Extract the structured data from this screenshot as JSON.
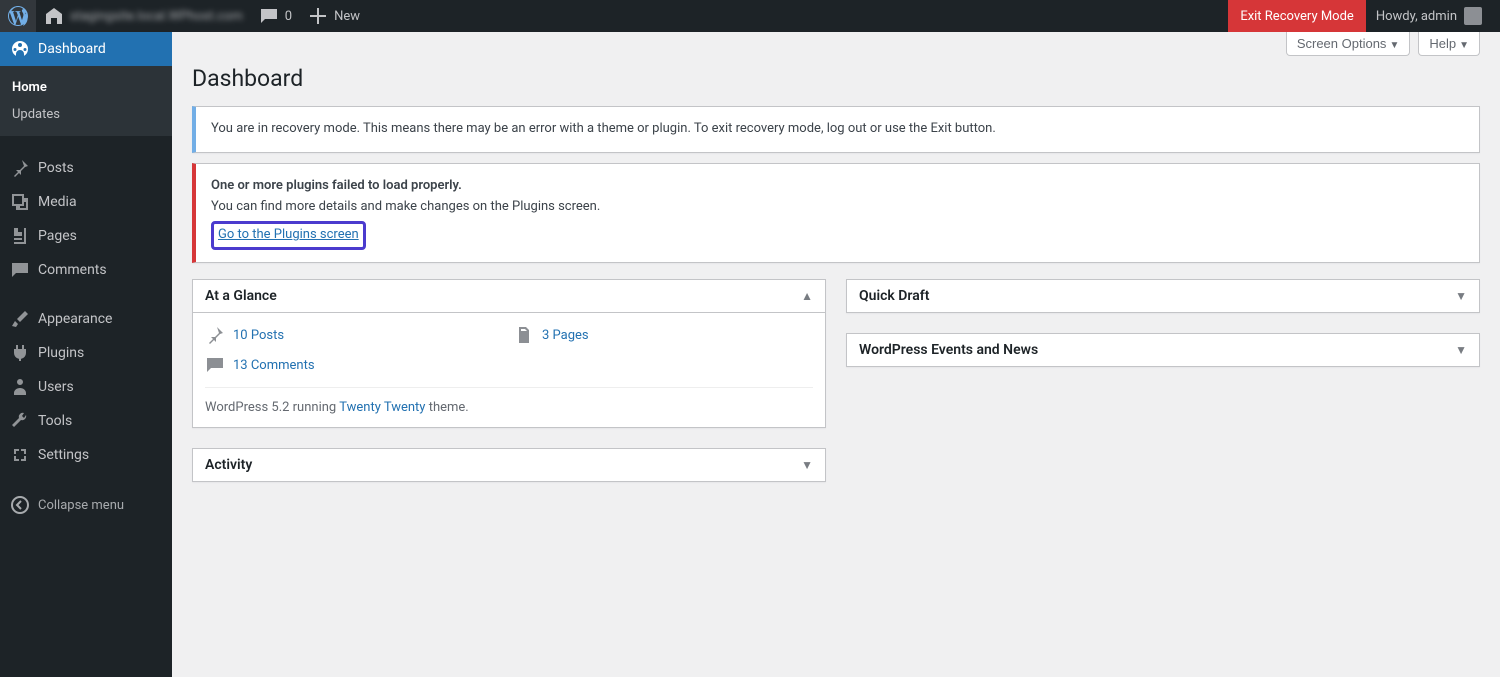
{
  "adminbar": {
    "site_name": "stagingsite.local.WPhost.com",
    "comments_count": "0",
    "new_label": "New",
    "exit_recovery": "Exit Recovery Mode",
    "howdy": "Howdy, admin"
  },
  "sidebar": {
    "dashboard": "Dashboard",
    "home": "Home",
    "updates": "Updates",
    "posts": "Posts",
    "media": "Media",
    "pages": "Pages",
    "comments": "Comments",
    "appearance": "Appearance",
    "plugins": "Plugins",
    "users": "Users",
    "tools": "Tools",
    "settings": "Settings",
    "collapse": "Collapse menu"
  },
  "toprow": {
    "screen_options": "Screen Options",
    "help": "Help"
  },
  "page_title": "Dashboard",
  "notice_info": "You are in recovery mode. This means there may be an error with a theme or plugin. To exit recovery mode, log out or use the Exit button.",
  "notice_error": {
    "line1": "One or more plugins failed to load properly.",
    "line2": "You can find more details and make changes on the Plugins screen.",
    "link": "Go to the Plugins screen"
  },
  "widgets": {
    "glance": {
      "title": "At a Glance",
      "posts": "10 Posts",
      "pages": "3 Pages",
      "comments": "13 Comments",
      "footer_pre": "WordPress 5.2 running ",
      "footer_theme": "Twenty Twenty",
      "footer_post": " theme."
    },
    "activity": {
      "title": "Activity"
    },
    "quickdraft": {
      "title": "Quick Draft"
    },
    "events": {
      "title": "WordPress Events and News"
    }
  }
}
